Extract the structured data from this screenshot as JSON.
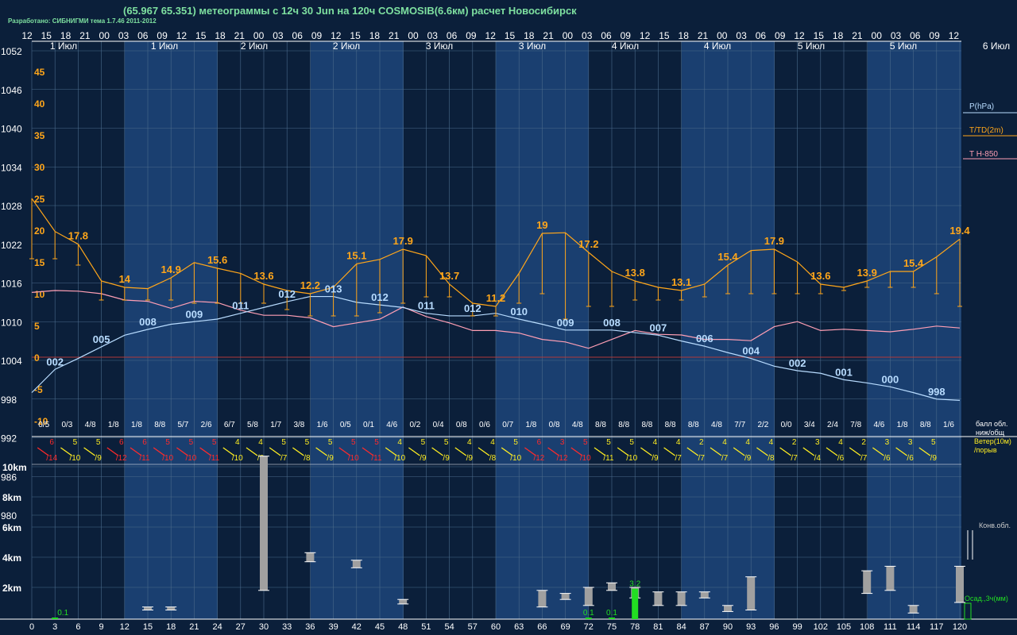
{
  "header": {
    "title": "(65.967 65.351) метеограммы с  12ч 30 Jun на 120ч COSMOSIB(6.6км) расчет Новосибирск",
    "credit": "Разработано: СИБНИГМИ тема 1.7.46 2011-2012"
  },
  "hour_ticks": [
    "12",
    "15",
    "18",
    "21",
    "00",
    "03",
    "06",
    "09",
    "12",
    "15",
    "18",
    "21",
    "00",
    "03",
    "06",
    "09",
    "12",
    "15",
    "18",
    "21",
    "00",
    "03",
    "06",
    "09",
    "12",
    "15",
    "18",
    "21",
    "00",
    "03",
    "06",
    "09",
    "12",
    "15",
    "18",
    "21",
    "00",
    "03",
    "06",
    "09",
    "12",
    "15",
    "18",
    "21",
    "00",
    "03",
    "06",
    "09",
    "12"
  ],
  "day_labels": [
    "1 Июл",
    "1 Июл",
    "2 Июл",
    "2 Июл",
    "3 Июл",
    "3 Июл",
    "4 Июл",
    "4 Июл",
    "5 Июл",
    "5 Июл",
    "6 Июл"
  ],
  "pressure_axis": [
    "1052",
    "1046",
    "1040",
    "1034",
    "1028",
    "1022",
    "1016",
    "1010",
    "1004",
    "998",
    "992",
    "986",
    "980"
  ],
  "temp_axis": [
    "45",
    "40",
    "35",
    "30",
    "25",
    "20",
    "15",
    "10",
    "5",
    "0",
    "-5",
    "-10"
  ],
  "height_axis": [
    "10km",
    "8km",
    "6km",
    "4km",
    "2km"
  ],
  "forecast_hours": [
    "0",
    "3",
    "6",
    "9",
    "12",
    "15",
    "18",
    "21",
    "24",
    "27",
    "30",
    "33",
    "36",
    "39",
    "42",
    "45",
    "48",
    "51",
    "54",
    "57",
    "60",
    "63",
    "66",
    "69",
    "72",
    "75",
    "78",
    "81",
    "84",
    "87",
    "90",
    "93",
    "96",
    "99",
    "102",
    "105",
    "108",
    "111",
    "114",
    "117",
    "120"
  ],
  "cloud_cover": [
    "0/5",
    "0/3",
    "4/8",
    "1/8",
    "1/8",
    "8/8",
    "5/7",
    "2/6",
    "6/7",
    "5/8",
    "1/7",
    "3/8",
    "1/6",
    "0/5",
    "0/1",
    "4/6",
    "0/2",
    "0/4",
    "0/8",
    "0/6",
    "0/7",
    "1/8",
    "0/8",
    "4/8",
    "8/8",
    "8/8",
    "8/8",
    "8/8",
    "8/8",
    "4/8",
    "7/7",
    "2/2",
    "0/0",
    "3/4",
    "2/4",
    "7/8",
    "4/6",
    "1/8",
    "8/8",
    "1/6"
  ],
  "wind_speed": [
    "6",
    "5",
    "5",
    "6",
    "6",
    "5",
    "5",
    "5",
    "4",
    "4",
    "5",
    "5",
    "5",
    "5",
    "5",
    "4",
    "5",
    "5",
    "4",
    "4",
    "5",
    "6",
    "3",
    "5",
    "5",
    "5",
    "4",
    "4",
    "2",
    "4",
    "4",
    "4",
    "2",
    "3",
    "4",
    "2",
    "3",
    "3",
    "5"
  ],
  "wind_gust": [
    "/14",
    "/10",
    "/9",
    "/12",
    "/11",
    "/10",
    "/10",
    "/11",
    "/10",
    "/8",
    "/7",
    "/8",
    "/9",
    "/10",
    "/11",
    "/10",
    "/9",
    "/9",
    "/9",
    "/8",
    "/10",
    "/12",
    "/12",
    "/10",
    "/11",
    "/10",
    "/9",
    "/7",
    "/7",
    "/7",
    "/9",
    "/8",
    "/7",
    "/4",
    "/6",
    "/7",
    "/6",
    "/6",
    "/9"
  ],
  "legend": {
    "pressure": "P(hPa)",
    "temp": "T/TD(2m)",
    "t850": "T H-850",
    "clouds_1": "балл обл.",
    "clouds_2": "ниж/общ",
    "wind_1": "Ветер(10м)",
    "wind_2": "/порыв",
    "conv": "Конв.обл.",
    "precip": "Осад.,3ч(мм)"
  },
  "colors": {
    "background": "#0b1f3a",
    "band_light": "#1a3f70",
    "grid": "#4a6a8a",
    "pressure": "#b8dcff",
    "temperature": "#ffa61a",
    "t850": "#ff9fb4",
    "zero_line": "#b03a3a",
    "wind_warm": "#ff2a2a",
    "wind_yellow": "#ffee22",
    "precip": "#22dd22",
    "conv_cloud": "#a0a0a0"
  },
  "chart_data": [
    {
      "type": "line",
      "x_unit": "forecast hour",
      "x": [
        0,
        3,
        6,
        9,
        12,
        15,
        18,
        21,
        24,
        27,
        30,
        33,
        36,
        39,
        42,
        45,
        48,
        51,
        54,
        57,
        60,
        63,
        66,
        69,
        72,
        75,
        78,
        81,
        84,
        87,
        90,
        93,
        96,
        99,
        102,
        105,
        108,
        111,
        114,
        117,
        120
      ],
      "ylim_pressure": [
        980,
        1052
      ],
      "ylim_temp": [
        -10,
        45
      ],
      "series": [
        {
          "name": "P(hPa)",
          "values": [
            999.0,
            1002.6,
            1004.3,
            1006.1,
            1007.9,
            1008.8,
            1009.6,
            1010.0,
            1010.4,
            1011.3,
            1012.2,
            1013.1,
            1013.9,
            1013.9,
            1013.0,
            1012.6,
            1012.2,
            1011.3,
            1010.9,
            1010.9,
            1011.3,
            1010.4,
            1009.6,
            1008.7,
            1008.7,
            1008.7,
            1008.3,
            1007.9,
            1007.0,
            1006.2,
            1005.2,
            1004.3,
            1003.1,
            1002.4,
            1002.0,
            1001.0,
            1000.5,
            999.9,
            999.0,
            998.0,
            997.8
          ],
          "labels": [
            {
              "i": 1,
              "text": "002"
            },
            {
              "i": 3,
              "text": "005"
            },
            {
              "i": 5,
              "text": "008"
            },
            {
              "i": 7,
              "text": "009"
            },
            {
              "i": 9,
              "text": "011"
            },
            {
              "i": 11,
              "text": "012"
            },
            {
              "i": 13,
              "text": "013"
            },
            {
              "i": 15,
              "text": "012"
            },
            {
              "i": 17,
              "text": "011"
            },
            {
              "i": 19,
              "text": "012"
            },
            {
              "i": 21,
              "text": "010"
            },
            {
              "i": 23,
              "text": "009"
            },
            {
              "i": 25,
              "text": "008"
            },
            {
              "i": 27,
              "text": "007"
            },
            {
              "i": 29,
              "text": "006"
            },
            {
              "i": 31,
              "text": "004"
            },
            {
              "i": 33,
              "text": "002"
            },
            {
              "i": 35,
              "text": "001"
            },
            {
              "i": 37,
              "text": "000"
            },
            {
              "i": 39,
              "text": "998"
            }
          ]
        },
        {
          "name": "T/TD(2m)",
          "values": [
            25.0,
            19.8,
            17.8,
            12.0,
            11.0,
            10.8,
            12.5,
            14.9,
            14.0,
            13.2,
            11.5,
            10.5,
            10.0,
            11.0,
            14.7,
            15.4,
            17.0,
            16.0,
            11.5,
            8.5,
            8.0,
            13.2,
            19.5,
            19.6,
            16.5,
            13.5,
            12.0,
            11.0,
            10.5,
            11.5,
            14.5,
            16.8,
            17.0,
            15.0,
            11.5,
            11.0,
            12.0,
            13.5,
            13.5,
            15.8,
            18.6
          ],
          "td_values": [
            15.5,
            15.5,
            14.5,
            9.0,
            9.0,
            9.0,
            9.0,
            8.5,
            8.5,
            8.5,
            8.5,
            7.5,
            6.5,
            6.5,
            6.5,
            7.0,
            8.5,
            9.5,
            9.5,
            6.5,
            6.5,
            8.5,
            10.0,
            6.0,
            8.0,
            8.0,
            9.0,
            9.0,
            9.0,
            9.5,
            10.0,
            10.0,
            10.0,
            10.0,
            10.0,
            10.5,
            11.0,
            11.0,
            11.0,
            10.0,
            8.0
          ],
          "labels": [
            {
              "i": 2,
              "text": "17.8"
            },
            {
              "i": 4,
              "text": "14"
            },
            {
              "i": 6,
              "text": "14.9"
            },
            {
              "i": 8,
              "text": "15.6"
            },
            {
              "i": 10,
              "text": "13.6"
            },
            {
              "i": 12,
              "text": "12.2"
            },
            {
              "i": 14,
              "text": "15.1"
            },
            {
              "i": 16,
              "text": "17.9"
            },
            {
              "i": 18,
              "text": "13.7"
            },
            {
              "i": 20,
              "text": "11.2"
            },
            {
              "i": 22,
              "text": "19"
            },
            {
              "i": 24,
              "text": "17.2"
            },
            {
              "i": 26,
              "text": "13.8"
            },
            {
              "i": 28,
              "text": "13.1"
            },
            {
              "i": 30,
              "text": "15.4"
            },
            {
              "i": 32,
              "text": "17.9"
            },
            {
              "i": 34,
              "text": "13.6"
            },
            {
              "i": 36,
              "text": "13.9"
            },
            {
              "i": 38,
              "text": "15.4"
            },
            {
              "i": 40,
              "text": "19.4"
            }
          ]
        },
        {
          "name": "T H-850",
          "values": [
            10.2,
            10.5,
            10.4,
            10.0,
            9.0,
            8.8,
            7.7,
            8.8,
            8.6,
            7.4,
            6.6,
            6.6,
            6.2,
            4.8,
            5.4,
            6.0,
            7.9,
            6.4,
            5.4,
            4.2,
            4.2,
            3.8,
            2.8,
            2.4,
            1.4,
            2.8,
            4.2,
            3.6,
            3.5,
            2.8,
            2.8,
            2.6,
            4.8,
            5.6,
            4.2,
            4.4,
            4.2,
            4.0,
            4.4,
            4.9,
            4.6
          ]
        }
      ]
    },
    {
      "type": "bar",
      "name": "Конв.обл.",
      "unit": "km",
      "segments": [
        {
          "h": 30,
          "bottom": 1.8,
          "top": 10.7
        },
        {
          "h": 36,
          "bottom": 3.7,
          "top": 4.3
        },
        {
          "h": 42,
          "bottom": 3.3,
          "top": 3.8
        },
        {
          "h": 48,
          "bottom": 0.9,
          "top": 1.2
        },
        {
          "h": 15,
          "bottom": 0.5,
          "top": 0.7
        },
        {
          "h": 18,
          "bottom": 0.5,
          "top": 0.7
        },
        {
          "h": 66,
          "bottom": 0.7,
          "top": 1.8
        },
        {
          "h": 69,
          "bottom": 1.2,
          "top": 1.6
        },
        {
          "h": 72,
          "bottom": 0.8,
          "top": 2.0
        },
        {
          "h": 75,
          "bottom": 1.8,
          "top": 2.3
        },
        {
          "h": 78,
          "bottom": 1.3,
          "top": 2.0
        },
        {
          "h": 81,
          "bottom": 0.8,
          "top": 1.7
        },
        {
          "h": 84,
          "bottom": 0.8,
          "top": 1.7
        },
        {
          "h": 87,
          "bottom": 1.3,
          "top": 1.7
        },
        {
          "h": 90,
          "bottom": 0.4,
          "top": 0.8
        },
        {
          "h": 93,
          "bottom": 0.5,
          "top": 2.7
        },
        {
          "h": 108,
          "bottom": 1.6,
          "top": 3.1
        },
        {
          "h": 111,
          "bottom": 1.8,
          "top": 3.4
        },
        {
          "h": 114,
          "bottom": 0.3,
          "top": 0.8
        },
        {
          "h": 120,
          "bottom": 1.0,
          "top": 3.4
        }
      ]
    },
    {
      "type": "bar",
      "name": "Осад.,3ч(мм)",
      "x": [
        3,
        72,
        75,
        78
      ],
      "values": [
        0.1,
        0.1,
        0.1,
        3.2
      ],
      "labels": [
        "0.1",
        "0.1",
        "0.1",
        "3.2"
      ]
    }
  ]
}
